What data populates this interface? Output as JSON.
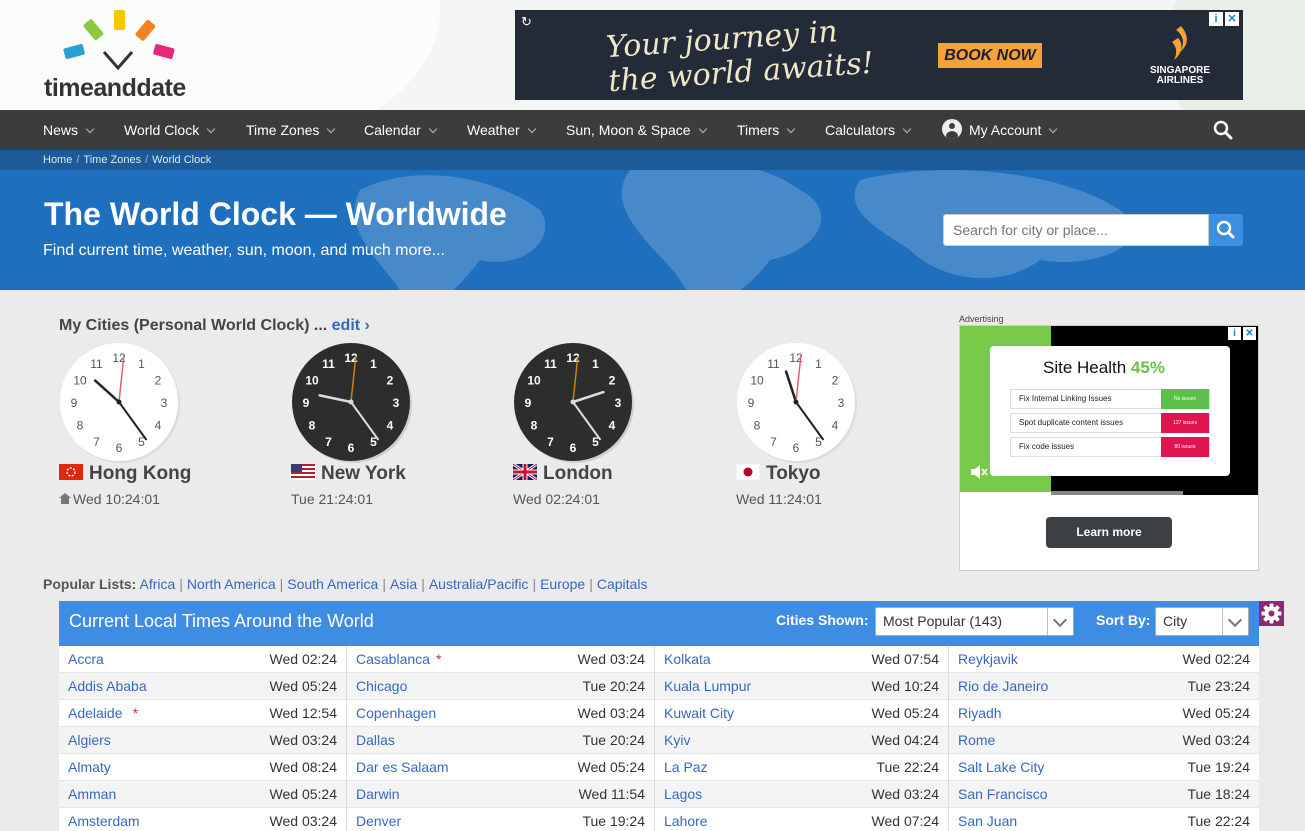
{
  "logo": {
    "text": "timeanddate"
  },
  "top_ad": {
    "line1": "Your journey in",
    "line2": "the world awaits!",
    "button": "BOOK NOW",
    "brand_line1": "SINGAPORE",
    "brand_line2": "AIRLINES",
    "info_glyph": "i",
    "close_glyph": "✕"
  },
  "nav": {
    "items": [
      "News",
      "World Clock",
      "Time Zones",
      "Calendar",
      "Weather",
      "Sun, Moon & Space",
      "Timers",
      "Calculators",
      "My Account"
    ]
  },
  "breadcrumb": [
    "Home",
    "Time Zones",
    "World Clock"
  ],
  "hero": {
    "title": "The World Clock — Worldwide",
    "subtitle": "Find current time, weather, sun, moon, and much more...",
    "search_placeholder": "Search for city or place..."
  },
  "my_cities": {
    "title": "My Cities (Personal World Clock) ...",
    "edit_label": "edit ›",
    "cities": [
      {
        "name": "Hong Kong",
        "time": "Wed 10:24:01",
        "flag": "hong-kong-flag",
        "theme": "light",
        "hour": 10,
        "minute": 24,
        "second": 1
      },
      {
        "name": "New York",
        "time": "Tue 21:24:01",
        "flag": "us-flag",
        "theme": "dark",
        "hour": 21,
        "minute": 24,
        "second": 1
      },
      {
        "name": "London",
        "time": "Wed 02:24:01",
        "flag": "uk-flag",
        "theme": "dark",
        "hour": 2,
        "minute": 24,
        "second": 1
      },
      {
        "name": "Tokyo",
        "time": "Wed 11:24:01",
        "flag": "japan-flag",
        "theme": "light",
        "hour": 11,
        "minute": 24,
        "second": 1
      }
    ],
    "dial_numbers": [
      "12",
      "1",
      "2",
      "3",
      "4",
      "5",
      "6",
      "7",
      "8",
      "9",
      "10",
      "11"
    ]
  },
  "side_ad": {
    "label": "Advertising",
    "title": "Site Health",
    "title_pct": "45%",
    "rows": [
      {
        "text": "Fix Internal Linking Issues",
        "pill": "No issues",
        "color": "#5cc04a"
      },
      {
        "text": "Spot duplicate content issues",
        "pill": "127 issues",
        "color": "#e0154f"
      },
      {
        "text": "Fix code issues",
        "pill": "80 issues",
        "color": "#e0154f"
      }
    ],
    "button": "Learn more",
    "info_glyph": "i",
    "close_glyph": "✕"
  },
  "popular": {
    "label": "Popular Lists:",
    "links": [
      "Africa",
      "North America",
      "South America",
      "Asia",
      "Australia/Pacific",
      "Europe",
      "Capitals"
    ]
  },
  "table": {
    "title": "Current Local Times Around the World",
    "cities_shown_label": "Cities Shown:",
    "cities_shown_value": "Most Popular (143)",
    "sort_label": "Sort By:",
    "sort_value": "City",
    "columns": [
      [
        {
          "city": "Accra",
          "star": "",
          "time": "Wed 02:24"
        },
        {
          "city": "Addis Ababa",
          "star": "",
          "time": "Wed 05:24"
        },
        {
          "city": "Adelaide",
          "star": "*",
          "time": "Wed 12:54"
        },
        {
          "city": "Algiers",
          "star": "",
          "time": "Wed 03:24"
        },
        {
          "city": "Almaty",
          "star": "",
          "time": "Wed 08:24"
        },
        {
          "city": "Amman",
          "star": "",
          "time": "Wed 05:24"
        },
        {
          "city": "Amsterdam",
          "star": "",
          "time": "Wed 03:24"
        }
      ],
      [
        {
          "city": "Casablanca",
          "star": "*",
          "time": "Wed 03:24"
        },
        {
          "city": "Chicago",
          "star": "",
          "time": "Tue 20:24"
        },
        {
          "city": "Copenhagen",
          "star": "",
          "time": "Wed 03:24"
        },
        {
          "city": "Dallas",
          "star": "",
          "time": "Tue 20:24"
        },
        {
          "city": "Dar es Salaam",
          "star": "",
          "time": "Wed 05:24"
        },
        {
          "city": "Darwin",
          "star": "",
          "time": "Wed 11:54"
        },
        {
          "city": "Denver",
          "star": "",
          "time": "Tue 19:24"
        }
      ],
      [
        {
          "city": "Kolkata",
          "star": "",
          "time": "Wed 07:54"
        },
        {
          "city": "Kuala Lumpur",
          "star": "",
          "time": "Wed 10:24"
        },
        {
          "city": "Kuwait City",
          "star": "",
          "time": "Wed 05:24"
        },
        {
          "city": "Kyiv",
          "star": "",
          "time": "Wed 04:24"
        },
        {
          "city": "La Paz",
          "star": "",
          "time": "Tue 22:24"
        },
        {
          "city": "Lagos",
          "star": "",
          "time": "Wed 03:24"
        },
        {
          "city": "Lahore",
          "star": "",
          "time": "Wed 07:24"
        }
      ],
      [
        {
          "city": "Reykjavik",
          "star": "",
          "time": "Wed 02:24"
        },
        {
          "city": "Rio de Janeiro",
          "star": "",
          "time": "Tue 23:24"
        },
        {
          "city": "Riyadh",
          "star": "",
          "time": "Wed 05:24"
        },
        {
          "city": "Rome",
          "star": "",
          "time": "Wed 03:24"
        },
        {
          "city": "Salt Lake City",
          "star": "",
          "time": "Tue 19:24"
        },
        {
          "city": "San Francisco",
          "star": "",
          "time": "Tue 18:24"
        },
        {
          "city": "San Juan",
          "star": "",
          "time": "Tue 22:24"
        }
      ]
    ]
  },
  "colors": {
    "nav_bg": "#3c3c3c",
    "hero_bg": "#1f6fbf",
    "table_header": "#3f8de3",
    "link": "#3767c0",
    "gear_bg": "#8a2a72"
  }
}
